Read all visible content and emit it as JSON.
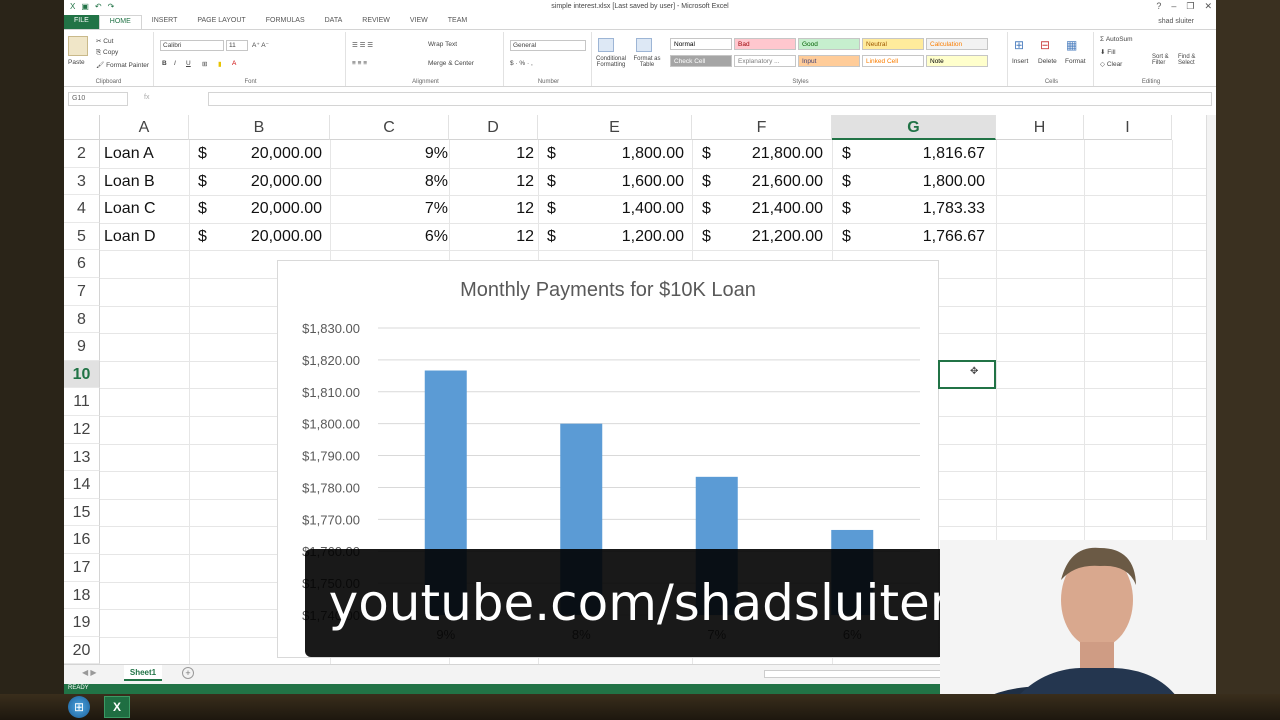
{
  "window": {
    "title": "simple interest.xlsx [Last saved by user] - Microsoft Excel",
    "user": "shad sluiter",
    "qat": [
      "X",
      "▣",
      "↶",
      "↷"
    ]
  },
  "ribbon": {
    "tabs": [
      "FILE",
      "HOME",
      "INSERT",
      "PAGE LAYOUT",
      "FORMULAS",
      "DATA",
      "REVIEW",
      "VIEW",
      "TEAM"
    ],
    "clipboard": {
      "paste": "Paste",
      "cut": "Cut",
      "copy": "Copy",
      "format_painter": "Format Painter",
      "label": "Clipboard"
    },
    "font": {
      "name": "Calibri",
      "size": "11",
      "label": "Font"
    },
    "alignment": {
      "wrap": "Wrap Text",
      "merge": "Merge & Center",
      "label": "Alignment"
    },
    "number": {
      "format": "General",
      "label": "Number"
    },
    "styles": {
      "conditional": "Conditional Formatting",
      "format_table": "Format as Table",
      "items": [
        {
          "name": "Normal",
          "bg": "#ffffff",
          "color": "#000000"
        },
        {
          "name": "Bad",
          "bg": "#ffc7ce",
          "color": "#9c0006"
        },
        {
          "name": "Good",
          "bg": "#c6efce",
          "color": "#006100"
        },
        {
          "name": "Neutral",
          "bg": "#ffeb9c",
          "color": "#9c5700"
        },
        {
          "name": "Calculation",
          "bg": "#f2f2f2",
          "color": "#fa7d00"
        },
        {
          "name": "Check Cell",
          "bg": "#a5a5a5",
          "color": "#ffffff"
        },
        {
          "name": "Explanatory ...",
          "bg": "#ffffff",
          "color": "#7f7f7f"
        },
        {
          "name": "Input",
          "bg": "#ffcc99",
          "color": "#3f3f76"
        },
        {
          "name": "Linked Cell",
          "bg": "#ffffff",
          "color": "#fa7d00"
        },
        {
          "name": "Note",
          "bg": "#ffffcc",
          "color": "#000000"
        }
      ],
      "label": "Styles"
    },
    "cells": {
      "insert": "Insert",
      "delete": "Delete",
      "format": "Format",
      "label": "Cells"
    },
    "editing": {
      "autosum": "AutoSum",
      "fill": "Fill",
      "clear": "Clear",
      "sort": "Sort & Filter",
      "find": "Find & Select",
      "label": "Editing"
    }
  },
  "formula_bar": {
    "name_box": "G10",
    "fx": "fx",
    "content": ""
  },
  "columns": [
    "A",
    "B",
    "C",
    "D",
    "E",
    "F",
    "G",
    "H",
    "I"
  ],
  "selected_column": "G",
  "rows": [
    "2",
    "3",
    "4",
    "5",
    "6",
    "7",
    "8",
    "9",
    "10",
    "11",
    "12",
    "13",
    "14",
    "15",
    "16",
    "17",
    "18",
    "19",
    "20"
  ],
  "selected_row": "10",
  "table": [
    {
      "name": "Loan A",
      "principal": "20,000.00",
      "rate": "9%",
      "months": "12",
      "interest": "1,800.00",
      "total": "21,800.00",
      "monthly": "1,816.67"
    },
    {
      "name": "Loan B",
      "principal": "20,000.00",
      "rate": "8%",
      "months": "12",
      "interest": "1,600.00",
      "total": "21,600.00",
      "monthly": "1,800.00"
    },
    {
      "name": "Loan C",
      "principal": "20,000.00",
      "rate": "7%",
      "months": "12",
      "interest": "1,400.00",
      "total": "21,400.00",
      "monthly": "1,783.33"
    },
    {
      "name": "Loan D",
      "principal": "20,000.00",
      "rate": "6%",
      "months": "12",
      "interest": "1,200.00",
      "total": "21,200.00",
      "monthly": "1,766.67"
    }
  ],
  "currency_symbol": "$",
  "chart_data": {
    "type": "bar",
    "title": "Monthly Payments for $10K Loan",
    "categories": [
      "9%",
      "8%",
      "7%",
      "6%"
    ],
    "values": [
      1816.67,
      1800.0,
      1783.33,
      1766.67
    ],
    "yticks": [
      "$1,830.00",
      "$1,820.00",
      "$1,810.00",
      "$1,800.00",
      "$1,790.00",
      "$1,780.00",
      "$1,770.00",
      "$1,760.00",
      "$1,750.00",
      "$1,740.00"
    ],
    "ylim": [
      1740,
      1830
    ],
    "grid": true,
    "bar_color": "#5b9bd5"
  },
  "sheet_tabs": [
    "Sheet1"
  ],
  "status": "READY",
  "overlay_text": "youtube.com/shadsluiter"
}
